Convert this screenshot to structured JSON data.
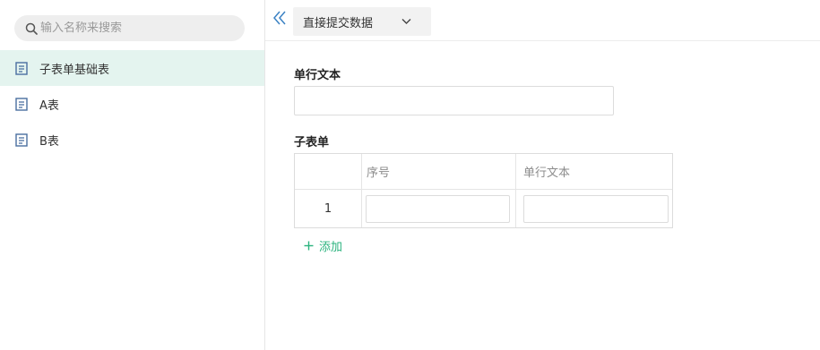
{
  "search": {
    "placeholder": "输入名称来搜索"
  },
  "sidebar": {
    "items": [
      {
        "label": "子表单基础表"
      },
      {
        "label": "A表"
      },
      {
        "label": "B表"
      }
    ]
  },
  "toolbar": {
    "tab_label": "直接提交数据"
  },
  "form": {
    "field1_label": "单行文本",
    "subform_label": "子表单",
    "table": {
      "columns": [
        "序号",
        "单行文本"
      ],
      "rows": [
        {
          "index": "1"
        }
      ]
    },
    "add_label": "添加"
  },
  "colors": {
    "accent": "#2bb37e",
    "active_bg": "#e4f4ef",
    "collapse_icon": "#3b82c4"
  }
}
